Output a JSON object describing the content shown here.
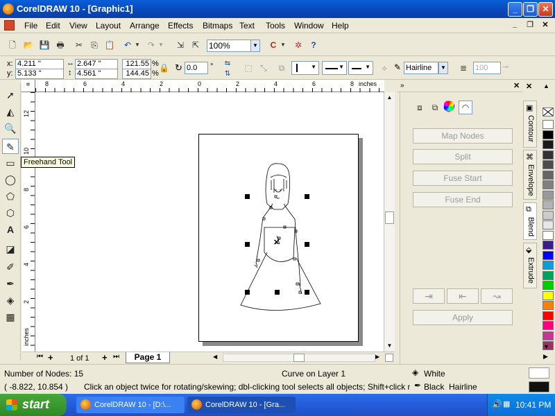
{
  "window": {
    "title": "CorelDRAW 10 - [Graphic1]"
  },
  "menu": [
    "File",
    "Edit",
    "View",
    "Layout",
    "Arrange",
    "Effects",
    "Bitmaps",
    "Text",
    "Tools",
    "Window",
    "Help"
  ],
  "standard_toolbar": {
    "zoom": "100%"
  },
  "property_bar": {
    "x": "4.211 ''",
    "y": "5.133 ''",
    "width": "2.647 ''",
    "height": "4.561 ''",
    "scale_x": "121.55",
    "scale_y": "144.45",
    "percent": "%",
    "angle": "0.0",
    "outline": "Hairline",
    "smoothness": "100"
  },
  "ruler": {
    "units": "inches",
    "h_ticks": [
      "8",
      "6",
      "4",
      "2",
      "0",
      "2",
      "4",
      "6",
      "8"
    ],
    "v_ticks": [
      "12",
      "10",
      "8",
      "6",
      "4",
      "2"
    ],
    "v_units": "inches"
  },
  "tooltip": "Freehand Tool",
  "page_nav": {
    "count": "1 of 1",
    "tab": "Page 1"
  },
  "docker": {
    "buttons": [
      "Map Nodes",
      "Split",
      "Fuse Start",
      "Fuse End"
    ],
    "apply": "Apply",
    "tabs": [
      "Contour",
      "Envelope",
      "Blend",
      "Extrude"
    ]
  },
  "palette": [
    "#ffffff",
    "#000000",
    "#1a1a1a",
    "#333333",
    "#4d4d4d",
    "#666666",
    "#808080",
    "#999999",
    "#b3b3b3",
    "#cccccc",
    "#e6e6e6",
    "#ffffff",
    "#3a1f8a",
    "#0000ff",
    "#00a0e0",
    "#00a060",
    "#00cc00",
    "#ffff00",
    "#ff8000",
    "#ff0000",
    "#ff0080",
    "#cc3399",
    "#993366"
  ],
  "status": {
    "nodes": "Number of Nodes: 15",
    "layer": "Curve on Layer 1",
    "fill": "White",
    "coords": "( -8.822, 10.854 )",
    "hint": "Click an object twice for rotating/skewing; dbl-clicking tool selects all objects; Shift+click multi-sele...",
    "outline": "Black  Hairline"
  },
  "taskbar": {
    "start": "start",
    "tasks": [
      "CorelDRAW 10 - [D:\\...",
      "CorelDRAW 10 - [Gra..."
    ],
    "clock": "10:41 PM"
  }
}
